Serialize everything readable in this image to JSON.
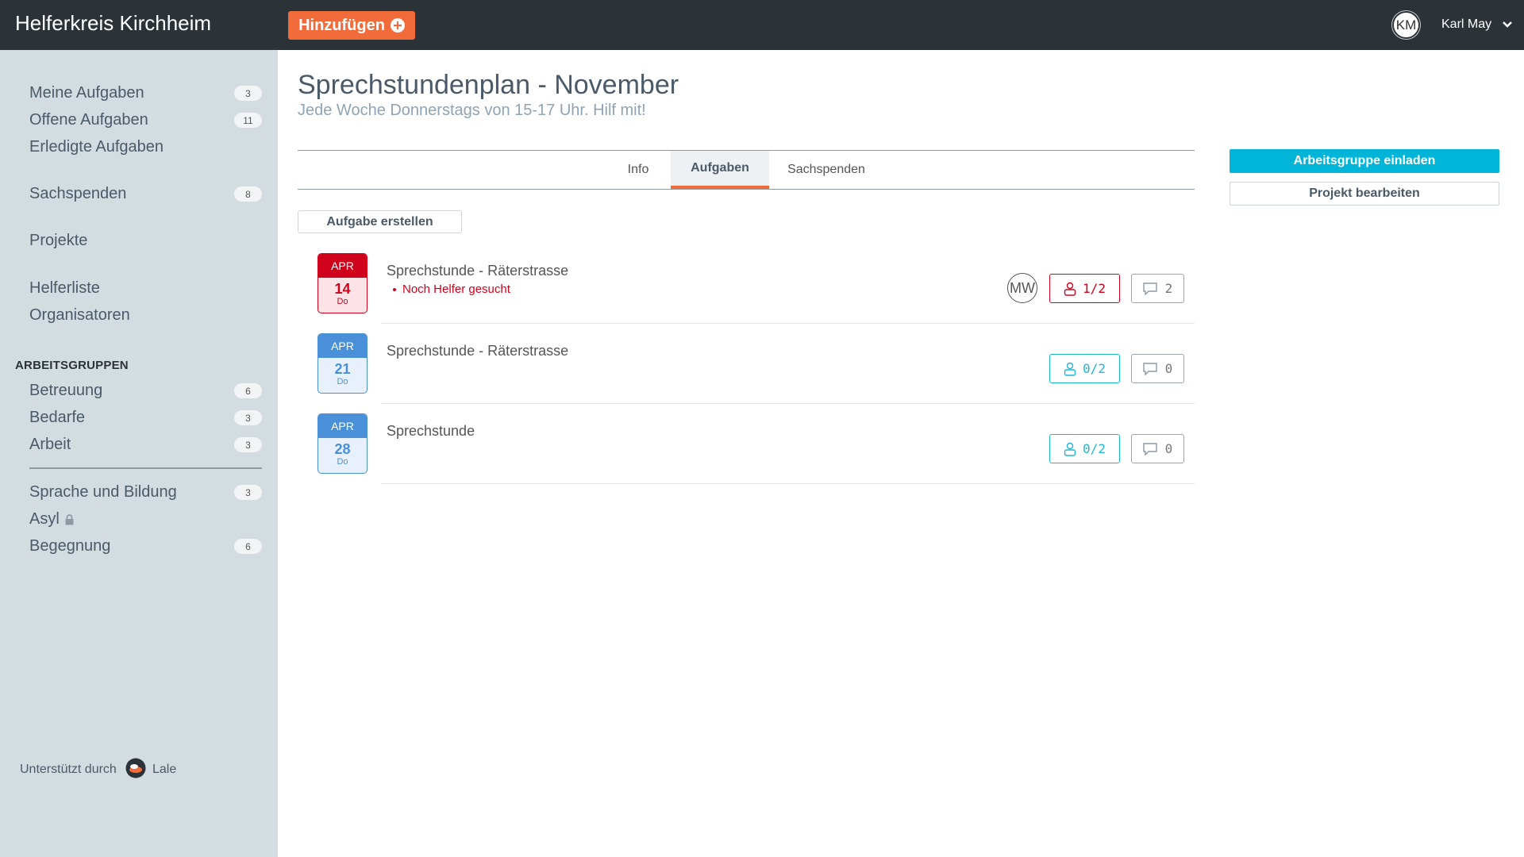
{
  "topbar": {
    "brand": "Helferkreis Kirchheim",
    "add_button": "Hinzufügen",
    "user_initials": "KM",
    "user_name": "Karl May"
  },
  "sidebar": {
    "items": [
      {
        "label": "Meine Aufgaben",
        "count": "3"
      },
      {
        "label": "Offene Aufgaben",
        "count": "11"
      },
      {
        "label": "Erledigte Aufgaben",
        "count": ""
      },
      {
        "label": "Sachspenden",
        "count": "8"
      },
      {
        "label": "Projekte",
        "count": ""
      },
      {
        "label": "Helferliste",
        "count": ""
      },
      {
        "label": "Organisatoren",
        "count": ""
      }
    ],
    "section_label": "ARBEITSGRUPPEN",
    "groups": [
      {
        "label": "Betreuung",
        "count": "6"
      },
      {
        "label": "Bedarfe",
        "count": "3"
      },
      {
        "label": "Arbeit",
        "count": "3"
      },
      {
        "label": "Sprache und Bildung",
        "count": "3"
      },
      {
        "label": "Asyl",
        "count": "",
        "locked": true
      },
      {
        "label": "Begegnung",
        "count": "6"
      }
    ],
    "footer_text": "Unterstützt durch",
    "footer_brand": "Lale"
  },
  "main": {
    "title": "Sprechstundenplan - November",
    "subtitle": "Jede Woche Donnerstags von 15-17 Uhr. Hilf mit!",
    "tabs": [
      {
        "label": "Info",
        "active": false
      },
      {
        "label": "Aufgaben",
        "active": true
      },
      {
        "label": "Sachspenden",
        "active": false
      }
    ],
    "create_button": "Aufgabe erstellen",
    "tasks": [
      {
        "month": "APR",
        "day": "14",
        "weekday": "Do",
        "title": "Sprechstunde - Räterstrasse",
        "status": "Noch Helfer gesucht",
        "helper": "MW",
        "slots": "1/2",
        "comments": "2",
        "state": "red"
      },
      {
        "month": "APR",
        "day": "21",
        "weekday": "Do",
        "title": "Sprechstunde - Räterstrasse",
        "status": "",
        "helper": "",
        "slots": "0/2",
        "comments": "0",
        "state": "blue"
      },
      {
        "month": "APR",
        "day": "28",
        "weekday": "Do",
        "title": "Sprechstunde",
        "status": "",
        "helper": "",
        "slots": "0/2",
        "comments": "0",
        "state": "blue"
      }
    ]
  },
  "actions": {
    "invite_button": "Arbeitsgruppe einladen",
    "edit_button": "Projekt bearbeiten"
  },
  "colors": {
    "topbar": "#2b3339",
    "accent_orange": "#f26b3a",
    "sidebar": "#d3dce1",
    "urgent_red": "#d0021b",
    "calendar_blue": "#4a90d9",
    "teal": "#00b5d8"
  }
}
